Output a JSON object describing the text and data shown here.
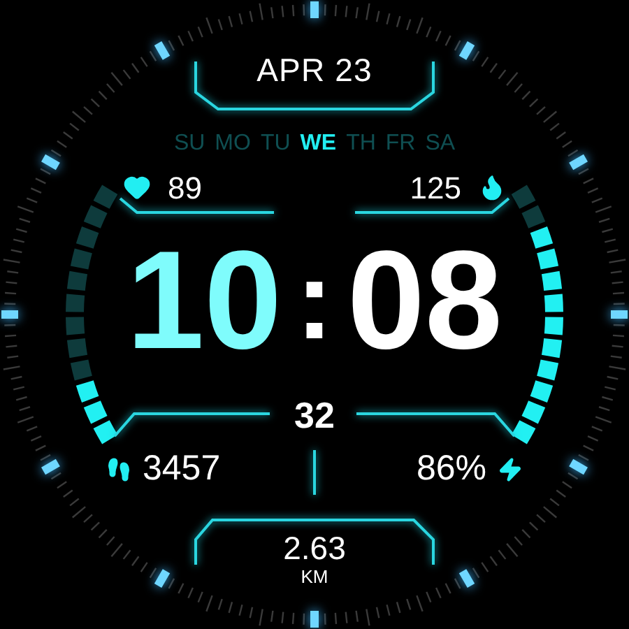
{
  "date": "APR 23",
  "weekdays": [
    {
      "label": "SU",
      "selected": false
    },
    {
      "label": "MO",
      "selected": false
    },
    {
      "label": "TU",
      "selected": false
    },
    {
      "label": "WE",
      "selected": true
    },
    {
      "label": "TH",
      "selected": false
    },
    {
      "label": "FR",
      "selected": false
    },
    {
      "label": "SA",
      "selected": false
    }
  ],
  "heart_rate": "89",
  "calories": "125",
  "time": {
    "hours": "10",
    "separator": ":",
    "minutes": "08"
  },
  "seconds": "32",
  "steps": "3457",
  "battery": "86%",
  "distance": {
    "value": "2.63",
    "unit": "KM"
  }
}
